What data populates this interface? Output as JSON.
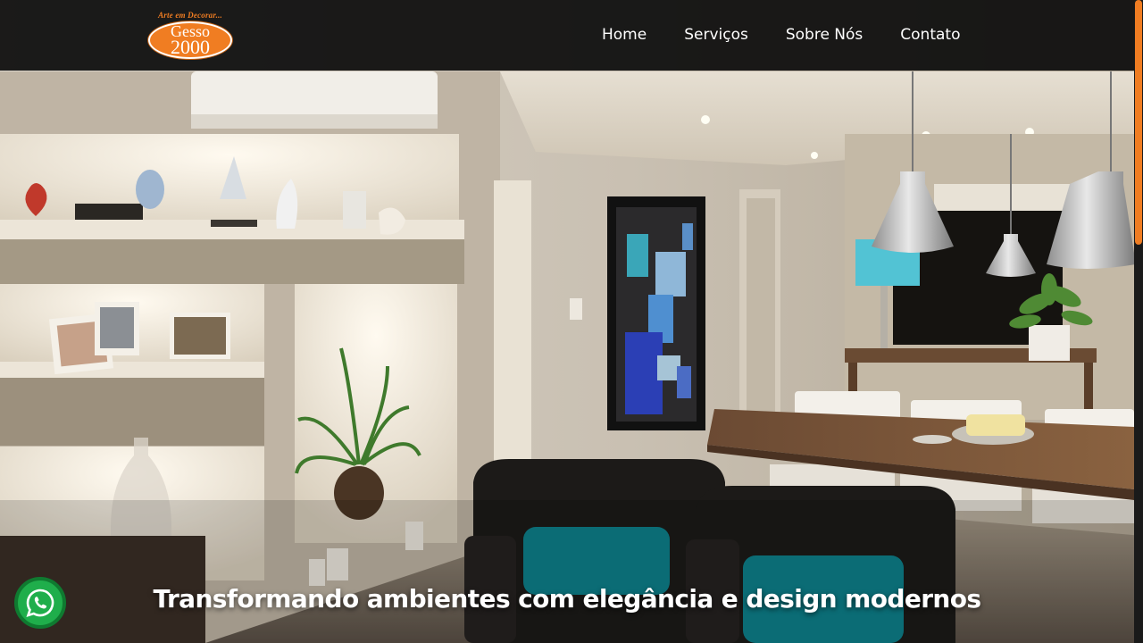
{
  "brand": {
    "tagline": "Arte em Decorar...",
    "name_line1": "Gesso",
    "name_line2": "2000"
  },
  "nav": {
    "items": [
      "Home",
      "Serviços",
      "Sobre Nós",
      "Contato"
    ]
  },
  "hero": {
    "headline": "Transformando ambientes com elegância e design modernos"
  },
  "icons": {
    "whatsapp": "whatsapp-icon"
  },
  "colors": {
    "accent": "#f07d22",
    "whatsapp": "#1fae4b",
    "navbar": "#0c0c0c"
  }
}
